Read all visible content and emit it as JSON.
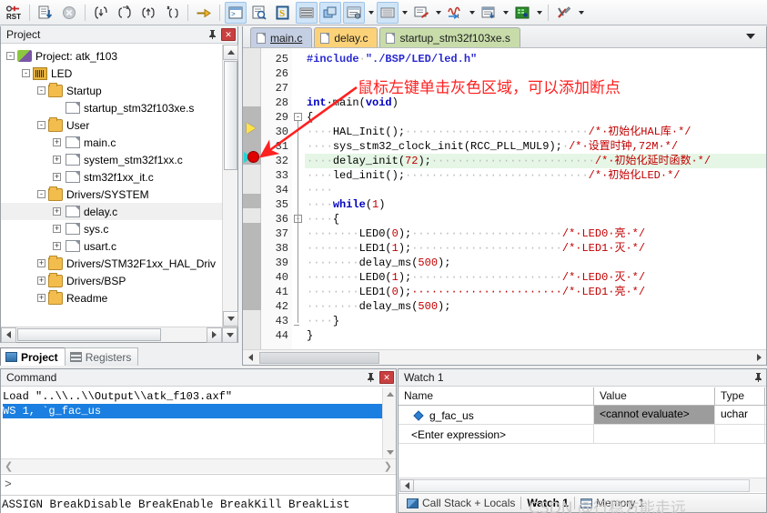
{
  "toolbar": {
    "buttons": [
      {
        "name": "reset-button",
        "label": "RST"
      },
      {
        "name": "run-to-cursor-button",
        "label": ""
      },
      {
        "name": "stop-button",
        "label": ""
      },
      {
        "name": "step-into-button",
        "label": "{}"
      },
      {
        "name": "step-over-button",
        "label": "{}"
      },
      {
        "name": "step-out-button",
        "label": "{}"
      },
      {
        "name": "run-to-line-button",
        "label": "*{}"
      },
      {
        "name": "show-next-statement-button",
        "label": ""
      },
      {
        "name": "command-window-button",
        "label": ""
      },
      {
        "name": "disassembly-window-button",
        "label": ""
      },
      {
        "name": "symbols-window-button",
        "label": "S"
      },
      {
        "name": "registers-window-button",
        "label": ""
      },
      {
        "name": "call-stack-window-button",
        "label": ""
      },
      {
        "name": "watch-windows-button",
        "label": ""
      },
      {
        "name": "memory-windows-button",
        "label": ""
      },
      {
        "name": "serial-windows-button",
        "label": ""
      },
      {
        "name": "analysis-windows-button",
        "label": ""
      },
      {
        "name": "trace-windows-button",
        "label": ""
      },
      {
        "name": "system-viewer-button",
        "label": ""
      },
      {
        "name": "toolbox-button",
        "label": ""
      }
    ]
  },
  "project_panel": {
    "title": "Project",
    "pin_icon": "pin-icon",
    "close_label": "✕",
    "tree": [
      {
        "label": "Project: atk_f103",
        "icon": "project-icon",
        "indent": 0,
        "expander": "-",
        "selected": false
      },
      {
        "label": "LED",
        "icon": "target-icon",
        "indent": 1,
        "expander": "-",
        "selected": false
      },
      {
        "label": "Startup",
        "icon": "folder-icon",
        "indent": 2,
        "expander": "-",
        "selected": false
      },
      {
        "label": "startup_stm32f103xe.s",
        "icon": "file-icon",
        "indent": 3,
        "expander": "",
        "selected": false
      },
      {
        "label": "User",
        "icon": "folder-icon",
        "indent": 2,
        "expander": "-",
        "selected": false
      },
      {
        "label": "main.c",
        "icon": "file-icon",
        "indent": 3,
        "expander": "+",
        "selected": false
      },
      {
        "label": "system_stm32f1xx.c",
        "icon": "file-icon",
        "indent": 3,
        "expander": "+",
        "selected": false
      },
      {
        "label": "stm32f1xx_it.c",
        "icon": "file-icon",
        "indent": 3,
        "expander": "+",
        "selected": false
      },
      {
        "label": "Drivers/SYSTEM",
        "icon": "folder-icon",
        "indent": 2,
        "expander": "-",
        "selected": false
      },
      {
        "label": "delay.c",
        "icon": "file-icon",
        "indent": 3,
        "expander": "+",
        "selected": true
      },
      {
        "label": "sys.c",
        "icon": "file-icon",
        "indent": 3,
        "expander": "+",
        "selected": false
      },
      {
        "label": "usart.c",
        "icon": "file-icon",
        "indent": 3,
        "expander": "+",
        "selected": false
      },
      {
        "label": "Drivers/STM32F1xx_HAL_Driv",
        "icon": "folder-icon",
        "indent": 2,
        "expander": "+",
        "selected": false
      },
      {
        "label": "Drivers/BSP",
        "icon": "folder-icon",
        "indent": 2,
        "expander": "+",
        "selected": false
      },
      {
        "label": "Readme",
        "icon": "folder-icon",
        "indent": 2,
        "expander": "+",
        "selected": false
      }
    ],
    "tabs": [
      {
        "label": "Project",
        "icon": "project-tab-icon",
        "active": true
      },
      {
        "label": "Registers",
        "icon": "registers-tab-icon",
        "active": false
      }
    ]
  },
  "editor": {
    "tabs": [
      {
        "label": "main.c",
        "active": true,
        "color": "#c5cfe4"
      },
      {
        "label": "delay.c",
        "active": false,
        "color": "#fcd279"
      },
      {
        "label": "startup_stm32f103xe.s",
        "active": false,
        "color": "#c8dcaa"
      }
    ],
    "tab_menu_icon": "chevron-down-icon",
    "annotation": "鼠标左键单击灰色区域，可以添加断点",
    "annotation_color": "#ff2020",
    "lines": [
      {
        "n": 25,
        "segments": [
          {
            "t": "#include",
            "c": "pp"
          },
          {
            "t": "·",
            "c": "dot"
          },
          {
            "t": "\"./BSP/LED/led.h\"",
            "c": "str"
          }
        ]
      },
      {
        "n": 26,
        "segments": []
      },
      {
        "n": 27,
        "segments": []
      },
      {
        "n": 28,
        "segments": [
          {
            "t": "int",
            "c": "kw"
          },
          {
            "t": "·main(",
            "c": ""
          },
          {
            "t": "void",
            "c": "kw"
          },
          {
            "t": ")",
            "c": ""
          }
        ]
      },
      {
        "n": 29,
        "segments": [
          {
            "t": "{",
            "c": ""
          }
        ],
        "fold": "-"
      },
      {
        "n": 30,
        "segments": [
          {
            "t": "····",
            "c": "dot"
          },
          {
            "t": "HAL_Init();",
            "c": ""
          },
          {
            "t": "····························",
            "c": "dot"
          },
          {
            "t": "/*·初始化HAL库·*/",
            "c": "cmt"
          }
        ],
        "marker": "yellow-arrow"
      },
      {
        "n": 31,
        "segments": [
          {
            "t": "····",
            "c": "dot"
          },
          {
            "t": "sys_stm32_clock_init(RCC_PLL_MUL9);",
            "c": ""
          },
          {
            "t": "·",
            "c": "dot"
          },
          {
            "t": "/*·设置时钟,72M·*/",
            "c": "cmt"
          }
        ]
      },
      {
        "n": 32,
        "segments": [
          {
            "t": "····",
            "c": "dot"
          },
          {
            "t": "delay_init(",
            "c": ""
          },
          {
            "t": "72",
            "c": "num"
          },
          {
            "t": ");",
            "c": ""
          },
          {
            "t": "·························",
            "c": "dot"
          },
          {
            "t": "/*·初始化延时函数·*/",
            "c": "cmt"
          }
        ],
        "highlight": true,
        "marker": "breakpoint"
      },
      {
        "n": 33,
        "segments": [
          {
            "t": "····",
            "c": "dot"
          },
          {
            "t": "led_init();",
            "c": ""
          },
          {
            "t": "····························",
            "c": "dot"
          },
          {
            "t": "/*·初始化LED·*/",
            "c": "cmt"
          }
        ]
      },
      {
        "n": 34,
        "segments": [
          {
            "t": "····",
            "c": "dot"
          }
        ]
      },
      {
        "n": 35,
        "segments": [
          {
            "t": "····",
            "c": "dot"
          },
          {
            "t": "while",
            "c": "kw"
          },
          {
            "t": "(",
            "c": ""
          },
          {
            "t": "1",
            "c": "num"
          },
          {
            "t": ")",
            "c": ""
          }
        ]
      },
      {
        "n": 36,
        "segments": [
          {
            "t": "····",
            "c": "dot"
          },
          {
            "t": "{",
            "c": ""
          }
        ],
        "fold": "-"
      },
      {
        "n": 37,
        "segments": [
          {
            "t": "········",
            "c": "dot"
          },
          {
            "t": "LED0(",
            "c": ""
          },
          {
            "t": "0",
            "c": "num"
          },
          {
            "t": ");",
            "c": ""
          },
          {
            "t": "·······················",
            "c": "dot"
          },
          {
            "t": "/*·LED0·亮·*/",
            "c": "cmt"
          }
        ]
      },
      {
        "n": 38,
        "segments": [
          {
            "t": "········",
            "c": "dot"
          },
          {
            "t": "LED1(",
            "c": ""
          },
          {
            "t": "1",
            "c": "num"
          },
          {
            "t": ");",
            "c": ""
          },
          {
            "t": "·······················",
            "c": "dot"
          },
          {
            "t": "/*·LED1·灭·*/",
            "c": "cmt"
          }
        ]
      },
      {
        "n": 39,
        "segments": [
          {
            "t": "········",
            "c": "dot"
          },
          {
            "t": "delay_ms(",
            "c": ""
          },
          {
            "t": "500",
            "c": "num"
          },
          {
            "t": ");",
            "c": ""
          }
        ]
      },
      {
        "n": 40,
        "segments": [
          {
            "t": "········",
            "c": "dot"
          },
          {
            "t": "LED0(",
            "c": ""
          },
          {
            "t": "1",
            "c": "num"
          },
          {
            "t": ");",
            "c": ""
          },
          {
            "t": "·······················",
            "c": "dot"
          },
          {
            "t": "/*·LED0·灭·*/",
            "c": "cmt"
          }
        ]
      },
      {
        "n": 41,
        "segments": [
          {
            "t": "········",
            "c": "dot"
          },
          {
            "t": "LED1(",
            "c": ""
          },
          {
            "t": "0",
            "c": "num"
          },
          {
            "t": ");",
            "c": ""
          },
          {
            "t": "·······················",
            "c": "cmt"
          },
          {
            "t": "/*·LED1·亮·*/",
            "c": "cmt"
          }
        ]
      },
      {
        "n": 42,
        "segments": [
          {
            "t": "········",
            "c": "dot"
          },
          {
            "t": "delay_ms(",
            "c": ""
          },
          {
            "t": "500",
            "c": "num"
          },
          {
            "t": ");",
            "c": ""
          }
        ]
      },
      {
        "n": 43,
        "segments": [
          {
            "t": "····",
            "c": "dot"
          },
          {
            "t": "}",
            "c": ""
          }
        ]
      },
      {
        "n": 44,
        "segments": [
          {
            "t": "}",
            "c": ""
          }
        ]
      }
    ]
  },
  "command_panel": {
    "title": "Command",
    "lines": [
      {
        "text": "Load \"..\\\\..\\\\Output\\\\atk_f103.axf\"",
        "selected": false
      },
      {
        "text": "WS 1, `g_fac_us",
        "selected": true
      }
    ],
    "prompt": ">",
    "hints": "ASSIGN BreakDisable BreakEnable BreakKill BreakList"
  },
  "watch_panel": {
    "title": "Watch 1",
    "columns": [
      "Name",
      "Value",
      "Type"
    ],
    "rows": [
      {
        "name": "g_fac_us",
        "value": "<cannot evaluate>",
        "type": "uchar",
        "has_marker": true
      },
      {
        "name": "<Enter expression>",
        "value": "",
        "type": "",
        "has_marker": false
      }
    ],
    "tabs": [
      {
        "label": "Call Stack + Locals",
        "active": false,
        "icon": "call-stack-icon"
      },
      {
        "label": "Watch 1",
        "active": true,
        "icon": ""
      },
      {
        "label": "Memory 1",
        "active": false,
        "icon": "memory-icon"
      }
    ],
    "watermark": "CSDN @行稳方能走远"
  }
}
